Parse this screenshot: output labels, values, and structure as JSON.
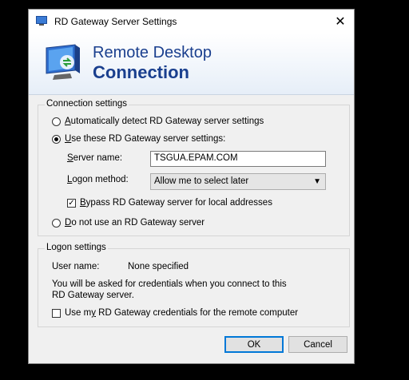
{
  "window": {
    "title": "RD Gateway Server Settings",
    "close_glyph": "✕"
  },
  "banner": {
    "line1": "Remote Desktop",
    "line2": "Connection",
    "icon": "remote-desktop-icon"
  },
  "connection_settings": {
    "legend": "Connection settings",
    "auto_detect": {
      "prefix": "A",
      "rest": "utomatically detect RD Gateway server settings",
      "selected": false
    },
    "use_these": {
      "prefix": "U",
      "rest": "se these RD Gateway server settings:",
      "selected": true
    },
    "server_name": {
      "label_prefix": "S",
      "label_rest": "erver name:",
      "value": "TSGUA.EPAM.COM"
    },
    "logon_method": {
      "label_prefix": "L",
      "label_rest": "ogon method:",
      "value": "Allow me to select later"
    },
    "bypass": {
      "prefix": "B",
      "rest": "ypass RD Gateway server for local addresses",
      "checked": true
    },
    "do_not_use": {
      "prefix": "D",
      "rest": "o not use an RD Gateway server",
      "selected": false
    }
  },
  "logon_settings": {
    "legend": "Logon settings",
    "user_name_label": "User name:",
    "user_name_value": "None specified",
    "info": "You will be asked for credentials when you connect to this RD Gateway server.",
    "use_credentials": {
      "prefix": "Use m",
      "underlined": "y",
      "rest": " RD Gateway credentials for the remote computer",
      "checked": false
    }
  },
  "buttons": {
    "ok": "OK",
    "cancel": "Cancel"
  }
}
